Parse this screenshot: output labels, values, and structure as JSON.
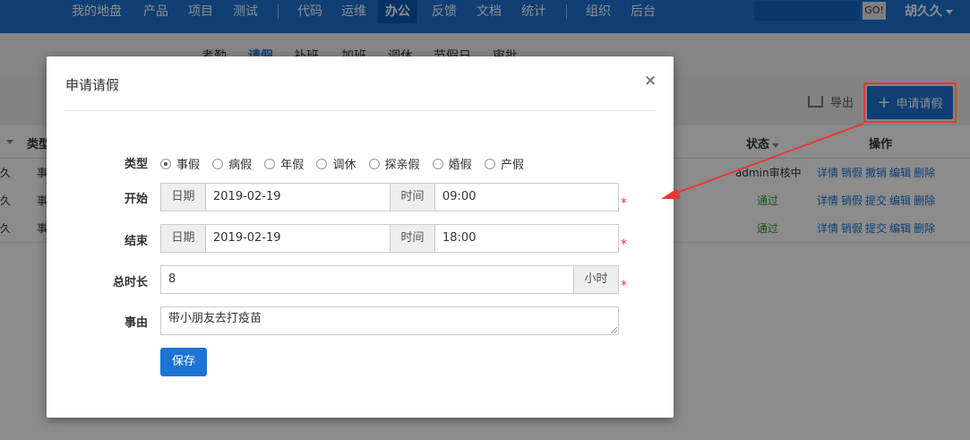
{
  "topnav": {
    "items": [
      "我的地盘",
      "产品",
      "项目",
      "测试",
      "代码",
      "运维",
      "办公",
      "反馈",
      "文档",
      "统计",
      "组织",
      "后台"
    ],
    "search_button": "GO!",
    "user": "胡久久"
  },
  "subnav": {
    "items": [
      "考勤",
      "请假",
      "补班",
      "加班",
      "调休",
      "节假日",
      "审批"
    ]
  },
  "toolbar": {
    "export_label": "导出",
    "apply_label": "申请请假"
  },
  "table": {
    "headers": {
      "type": "类型",
      "status": "状态",
      "actions": "操作"
    },
    "rows": [
      {
        "user_fragment": "久",
        "type_fragment": "事",
        "status": "admin审核中",
        "actions": [
          "详情",
          "销假",
          "撤销",
          "编辑",
          "删除"
        ]
      },
      {
        "user_fragment": "久",
        "type_fragment": "事",
        "status": "通过",
        "actions": [
          "详情",
          "销假",
          "提交",
          "编辑",
          "删除"
        ]
      },
      {
        "user_fragment": "久",
        "type_fragment": "事",
        "status": "通过",
        "actions": [
          "详情",
          "销假",
          "提交",
          "编辑",
          "删除"
        ]
      }
    ]
  },
  "modal": {
    "title": "申请请假",
    "close_symbol": "×",
    "labels": {
      "type": "类型",
      "start": "开始",
      "end": "结束",
      "duration": "总时长",
      "reason": "事由"
    },
    "leave_types": [
      "事假",
      "病假",
      "年假",
      "调休",
      "探亲假",
      "婚假",
      "产假"
    ],
    "selected_type": "事假",
    "date_addon": "日期",
    "time_addon": "时间",
    "start_date": "2019-02-19",
    "start_time": "09:00",
    "end_date": "2019-02-19",
    "end_time": "18:00",
    "duration_value": "8",
    "duration_unit": "小时",
    "reason_value": "带小朋友去打疫苗",
    "required_mark": "*",
    "save_label": "保存"
  },
  "colors": {
    "brand_blue": "#1d74d6",
    "annotation_red": "#e53935",
    "pass_green": "#2e9b3a"
  }
}
